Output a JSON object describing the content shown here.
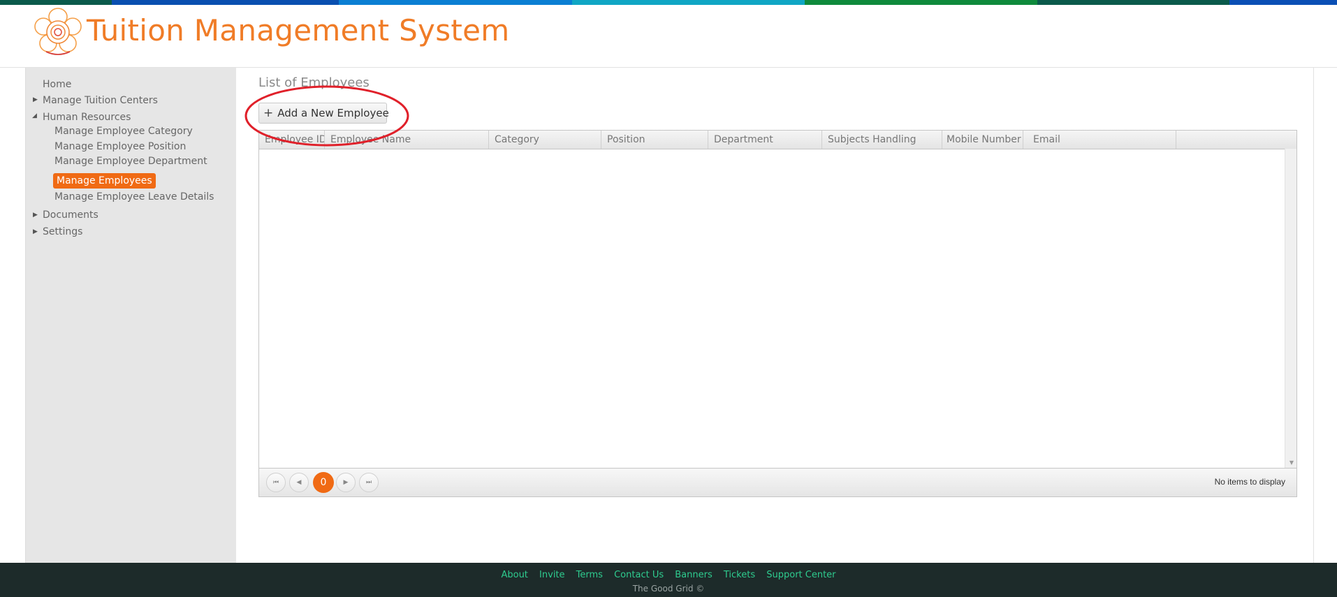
{
  "header": {
    "app_title": "Tuition Management System",
    "brand_color": "#f07c27"
  },
  "topbar": {
    "colors": [
      "#0b5a4b",
      "#0a4fb0",
      "#0b7fd3",
      "#10a6c4",
      "#0f8a3c",
      "#0b5a4b",
      "#0b4fb5"
    ]
  },
  "sidebar": {
    "home": "Home",
    "tuition_centers": "Manage Tuition Centers",
    "human_resources": "Human Resources",
    "hr_items": [
      "Manage Employee Category",
      "Manage Employee Position",
      "Manage Employee Department",
      "Manage Employees",
      "Manage Employee Leave Details"
    ],
    "documents": "Documents",
    "settings": "Settings",
    "active_color": "#f06a14"
  },
  "main": {
    "page_title": "List of Employees",
    "add_button": "Add a New Employee",
    "grid": {
      "columns": [
        "Employee ID",
        "Employee Name",
        "Category",
        "Position",
        "Department",
        "Subjects Handling",
        "Mobile Number",
        "Email"
      ],
      "rows": []
    },
    "pager": {
      "current_page": "0",
      "info": "No items to display"
    }
  },
  "footer": {
    "links": [
      "About",
      "Invite",
      "Terms",
      "Contact Us",
      "Banners",
      "Tickets",
      "Support Center"
    ],
    "copyright": "The Good Grid ©",
    "link_color": "#2ecc8f"
  }
}
